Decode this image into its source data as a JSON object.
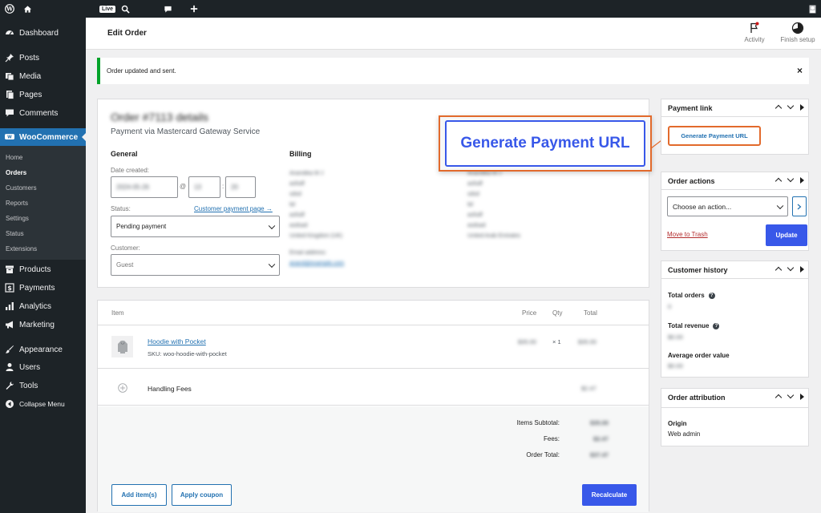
{
  "adminbar": {
    "live_badge": "Live"
  },
  "sidebar": {
    "items": [
      {
        "label": "Dashboard",
        "icon": "dashboard-icon"
      },
      {
        "label": "Posts",
        "icon": "pin-icon"
      },
      {
        "label": "Media",
        "icon": "media-icon"
      },
      {
        "label": "Pages",
        "icon": "pages-icon"
      },
      {
        "label": "Comments",
        "icon": "comment-icon"
      },
      {
        "label": "WooCommerce",
        "icon": "woo-icon"
      },
      {
        "label": "Products",
        "icon": "archive-icon"
      },
      {
        "label": "Payments",
        "icon": "dollar-icon"
      },
      {
        "label": "Analytics",
        "icon": "bar-chart-icon"
      },
      {
        "label": "Marketing",
        "icon": "megaphone-icon"
      },
      {
        "label": "Appearance",
        "icon": "brush-icon"
      },
      {
        "label": "Users",
        "icon": "user-icon"
      },
      {
        "label": "Tools",
        "icon": "wrench-icon"
      },
      {
        "label": "Collapse Menu",
        "icon": "collapse-icon"
      }
    ],
    "submenu": [
      "Home",
      "Orders",
      "Customers",
      "Reports",
      "Settings",
      "Status",
      "Extensions"
    ]
  },
  "header": {
    "title": "Edit Order",
    "activity": "Activity",
    "finish_setup": "Finish setup"
  },
  "notice": {
    "text": "Order updated and sent.",
    "dismiss": "×"
  },
  "order": {
    "title": "Order #7113 details",
    "subtitle": "Payment via Mastercard Gateway Service",
    "general_heading": "General",
    "date_label": "Date created:",
    "date_value": "2024-05-26",
    "at_symbol": "@",
    "hour": "13",
    "colon": ":",
    "minute": "20",
    "status_label": "Status:",
    "customer_payment_link": "Customer payment page →",
    "status_value": "Pending payment",
    "customer_label": "Customer:",
    "customer_value": "Guest",
    "billing_heading": "Billing",
    "billing_lines": [
      "Anandika M J",
      "asfsdf",
      "sdsd",
      "lal",
      "asfsdf",
      "asdsad",
      "United Kingdom (UK)"
    ],
    "email_label": "Email address:",
    "email_value": "anand@example.com",
    "shipping_lines": [
      "Anandika M J",
      "asfsdf",
      "sdsd",
      "lal",
      "asfsdf",
      "asdsad",
      "United Arab Emirates"
    ],
    "generate_callout": "Generate Payment URL"
  },
  "items": {
    "col_item": "Item",
    "col_price": "Price",
    "col_qty": "Qty",
    "col_total": "Total",
    "product_name": "Hoodie with Pocket",
    "sku_label": "SKU:",
    "sku_value": "woo-hoodie-with-pocket",
    "product_price": "$35.00",
    "product_qty": "× 1",
    "product_total": "$35.00",
    "fee_name": "Handling Fees",
    "fee_total": "$2.47",
    "subtotal_label": "Items Subtotal:",
    "subtotal_value": "$35.00",
    "fees_label": "Fees:",
    "fees_value": "$2.47",
    "order_total_label": "Order Total:",
    "order_total_value": "$37.47",
    "add_items": "Add item(s)",
    "apply_coupon": "Apply coupon",
    "recalculate": "Recalculate"
  },
  "payment_link": {
    "title": "Payment link",
    "button": "Generate Payment URL"
  },
  "order_actions": {
    "title": "Order actions",
    "select_value": "Choose an action...",
    "trash": "Move to Trash",
    "update": "Update"
  },
  "customer_history": {
    "title": "Customer history",
    "total_orders_label": "Total orders",
    "total_orders_value": "0",
    "total_revenue_label": "Total revenue",
    "total_revenue_value": "$0.00",
    "aov_label": "Average order value",
    "aov_value": "$0.00"
  },
  "order_attribution": {
    "title": "Order attribution",
    "origin_label": "Origin",
    "origin_value": "Web admin"
  },
  "colors": {
    "accent": "#3858e9",
    "wp_blue": "#2271b1",
    "highlight_orange": "#e26a2c",
    "success_green": "#00a32a",
    "trash_red": "#b32d2e"
  }
}
